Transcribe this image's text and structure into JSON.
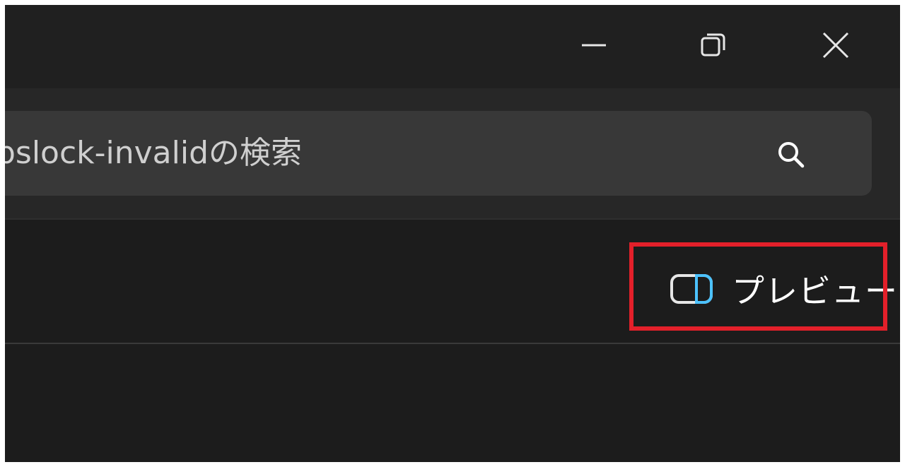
{
  "window_controls": {
    "minimize_icon": "minimize-icon",
    "maximize_icon": "restore-icon",
    "close_icon": "close-icon"
  },
  "search": {
    "value": "apslock-invalidの検索",
    "icon": "search-icon"
  },
  "toolbar": {
    "preview_label": "プレビュー",
    "preview_icon": "preview-pane-icon",
    "accent_color": "#4cc2ff"
  },
  "annotation": {
    "highlight_color": "#e3202a"
  }
}
